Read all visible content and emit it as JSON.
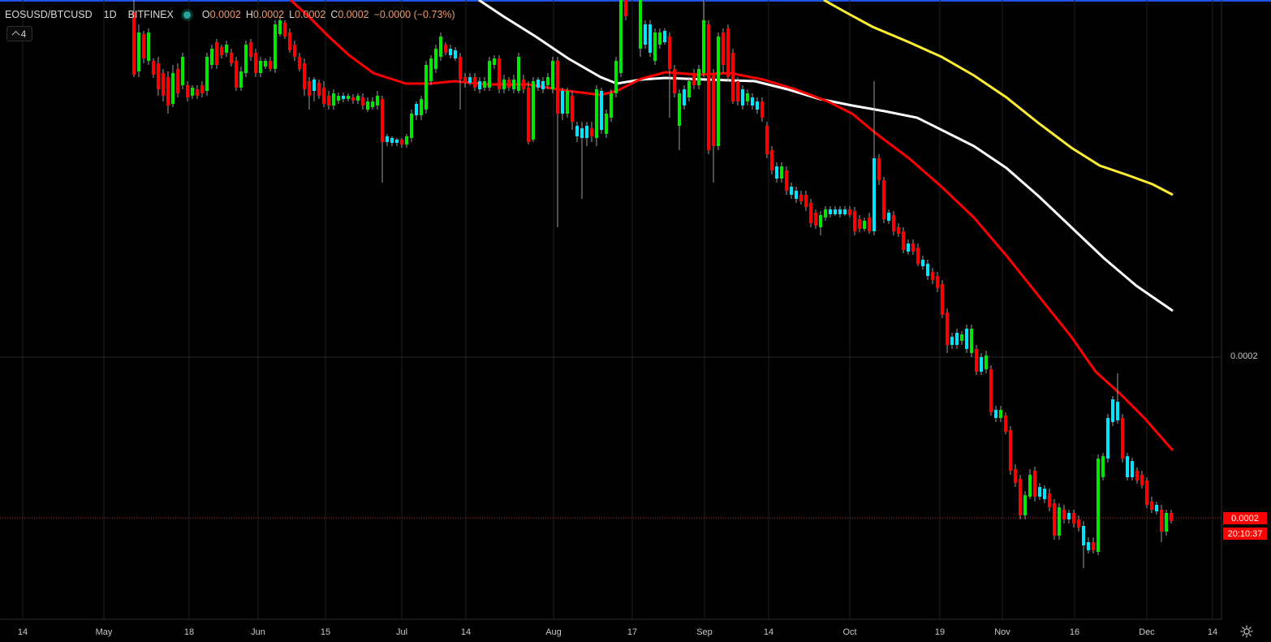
{
  "header": {
    "symbol": "EOSUSD/BTCUSD",
    "interval": "1D",
    "exchange": "BITFINEX",
    "open_label": "O",
    "open_value": "0.0002",
    "high_label": "H",
    "high_value": "0.0002",
    "low_label": "L",
    "low_value": "0.0002",
    "close_label": "C",
    "close_value": "0.0002",
    "change": "−0.0000 (−0.73%)",
    "collapse_count": "4"
  },
  "price_axis": {
    "labels": [
      "0.0002"
    ],
    "last_price": "0.0002",
    "countdown": "20:10:37"
  },
  "time_axis": {
    "labels": [
      "14",
      "May",
      "18",
      "Jun",
      "15",
      "Jul",
      "14",
      "Aug",
      "17",
      "Sep",
      "14",
      "Oct",
      "19",
      "Nov",
      "16",
      "Dec",
      "14"
    ]
  },
  "colors": {
    "up": "#00e600",
    "down": "#ff0000",
    "up_doji": "#00e5ff",
    "ma_fast": "#ff0000",
    "ma_mid": "#ffffff",
    "ma_slow": "#ffee33",
    "last_price_line": "#ff3b3b",
    "frame": "#1e53e5"
  },
  "chart_data": {
    "type": "candlestick",
    "title": "EOSUSD/BTCUSD",
    "interval": "1D",
    "source": "BITFINEX",
    "x_axis": [
      "14",
      "May",
      "18",
      "Jun",
      "15",
      "Jul",
      "14",
      "Aug",
      "17",
      "Sep",
      "14",
      "Oct",
      "19",
      "Nov",
      "16",
      "Dec",
      "14"
    ],
    "y_axis_labels": [
      "0.0002"
    ],
    "last_close": "0.0002",
    "moving_averages": [
      {
        "color": "#ff0000"
      },
      {
        "color": "#ffffff"
      },
      {
        "color": "#ffee33"
      }
    ],
    "grid": true
  }
}
